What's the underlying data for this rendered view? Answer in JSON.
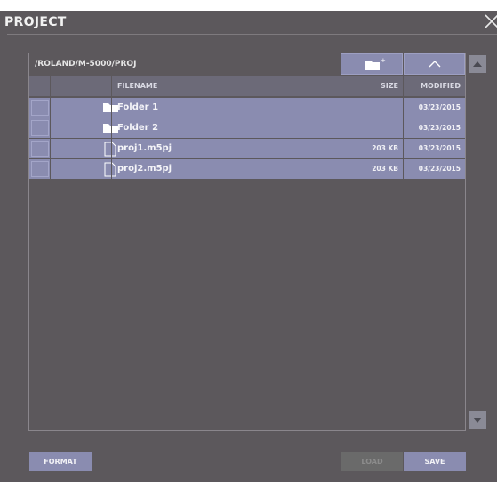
{
  "window": {
    "title": "PROJECT",
    "close_icon": "close-icon"
  },
  "browser": {
    "path": "/ROLAND/M-5000/PROJ",
    "new_folder_icon": "new-folder-icon",
    "up_icon": "chevron-up-icon"
  },
  "table": {
    "headers": {
      "filename": "FILENAME",
      "size": "SIZE",
      "modified": "MODIFIED"
    },
    "rows": [
      {
        "icon": "folder-icon",
        "name": "Folder 1",
        "size": "",
        "modified": "03/23/2015"
      },
      {
        "icon": "folder-icon",
        "name": "Folder 2",
        "size": "",
        "modified": "03/23/2015"
      },
      {
        "icon": "file-icon",
        "name": "proj1.m5pj",
        "size": "203 KB",
        "modified": "03/23/2015"
      },
      {
        "icon": "file-icon",
        "name": "proj2.m5pj",
        "size": "203 KB",
        "modified": "03/23/2015"
      }
    ]
  },
  "footer": {
    "format_label": "FORMAT",
    "load_label": "LOAD",
    "save_label": "SAVE"
  },
  "colors": {
    "background": "#5c585c",
    "accent": "#8a8cb0",
    "header_row": "#6c6a78",
    "disabled": "#6a6a6a"
  }
}
